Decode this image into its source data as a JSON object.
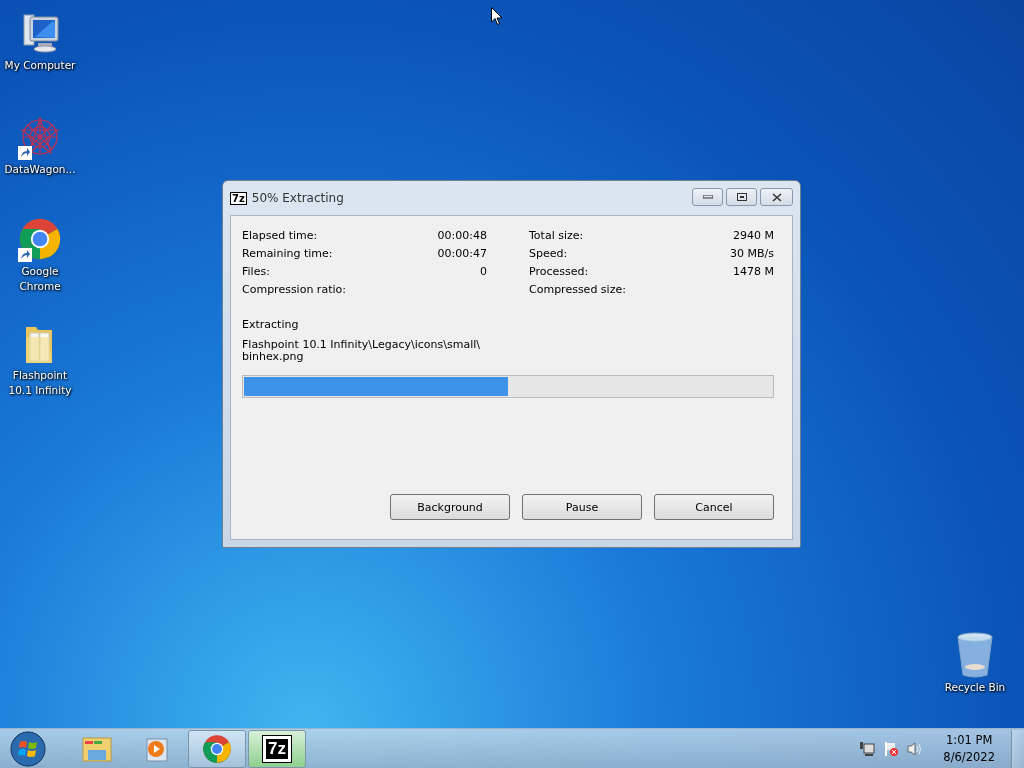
{
  "desktop_icons": [
    {
      "label": "My Computer",
      "kind": "computer",
      "shortcut": false
    },
    {
      "label": "DataWagon...",
      "kind": "datawagon",
      "shortcut": true
    },
    {
      "label": "Google Chrome",
      "kind": "chrome",
      "shortcut": true
    },
    {
      "label": "Flashpoint 10.1 Infinity",
      "kind": "folder",
      "shortcut": false
    },
    {
      "label": "Recycle Bin",
      "kind": "recycle",
      "shortcut": false
    }
  ],
  "dialog": {
    "app_icon_text": "7z",
    "title": "50% Extracting",
    "stats_left": [
      {
        "label": "Elapsed time:",
        "value": "00:00:48"
      },
      {
        "label": "Remaining time:",
        "value": "00:00:47"
      },
      {
        "label": "Files:",
        "value": "0"
      },
      {
        "label": "Compression ratio:"
      }
    ],
    "stats_right": [
      {
        "label": "Total size:",
        "value": "2940 M"
      },
      {
        "label": "Speed:",
        "value": "30 MB/s"
      },
      {
        "label": "Processed:",
        "value": "1478 M"
      },
      {
        "label": "Compressed size:"
      }
    ],
    "operation": "Extracting",
    "file_path": "Flashpoint 10.1 Infinity\\Legacy\\icons\\small\\ binhex.png",
    "progress": {
      "level": 0.5
    },
    "buttons": [
      "Background",
      "Pause",
      "Cancel"
    ]
  },
  "taskbar": {
    "apps": [
      {
        "kind": "explorer",
        "running": false,
        "selected": false
      },
      {
        "kind": "media",
        "running": false,
        "selected": false
      },
      {
        "kind": "chrome",
        "running": true,
        "selected": false
      },
      {
        "kind": "sevenzip",
        "label": "7z",
        "running": true,
        "selected": true
      }
    ],
    "clock_time": "1:01 PM",
    "clock_date": "8/6/2022"
  }
}
